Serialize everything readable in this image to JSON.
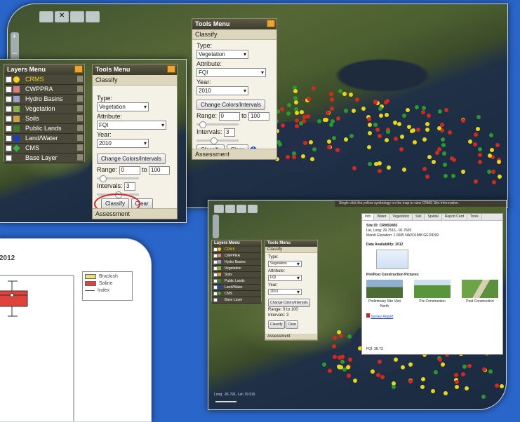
{
  "layers_menu": {
    "title": "Layers Menu",
    "items": [
      {
        "label": "CRMS",
        "icon": "yellow-circle-icon",
        "color": "#f2d21c"
      },
      {
        "label": "CWPPRA",
        "icon": "cwppra-icon",
        "color": "#d97f7f"
      },
      {
        "label": "Hydro Basins",
        "icon": "hydro-basins-icon",
        "color": "#9aa2c8"
      },
      {
        "label": "Vegetation",
        "icon": "vegetation-icon",
        "color": "#8ab04a"
      },
      {
        "label": "Soils",
        "icon": "soils-icon",
        "color": "#c9a347"
      },
      {
        "label": "Public Lands",
        "icon": "public-lands-icon",
        "color": "#3d7d2e"
      },
      {
        "label": "Land/Water",
        "icon": "land-water-icon",
        "color": "#1e3fb8"
      },
      {
        "label": "CMS",
        "icon": "green-diamond-icon",
        "color": "#35b24a"
      },
      {
        "label": "Base Layer",
        "icon": "",
        "color": ""
      }
    ]
  },
  "tools_menu": {
    "title": "Tools Menu",
    "tab": "Classify",
    "type_label": "Type:",
    "type_value": "Vegetation",
    "attribute_label": "Attribute:",
    "attribute_value": "FQI",
    "year_label": "Year:",
    "year_value": "2010",
    "change_button": "Change Colors/Intervals",
    "range_label": "Range:",
    "range_from": "0",
    "range_to_label": "to",
    "range_to": "100",
    "intervals_label": "Intervals:",
    "intervals_value": "3",
    "classify_button": "Classify",
    "clear_button": "Clear",
    "assessment": "Assessment"
  },
  "chart_panel": {
    "title_fragment": "2012",
    "legend": [
      {
        "label": "Brackish",
        "color": "#e9e36a"
      },
      {
        "label": "Saline",
        "color": "#e0433b"
      },
      {
        "label": "Index",
        "color": "#555555"
      }
    ]
  },
  "info_window": {
    "tabs": [
      "Info",
      "Water",
      "Vegetation",
      "Soil",
      "Spatial",
      "Report Card",
      "Tools"
    ],
    "site_id": "Site ID: CRMS0493",
    "lat_long": "Lat, Long: 29.7516, -91.7605",
    "marsh_elev": "Marsh Elevation: 1.0605 NAVD1988 GEOID99",
    "data_avail": "Data Availability: 2012",
    "pictures_title": "Pre/Post Construction Pictures:",
    "pictures": [
      "Preliminary Site Visit North",
      "Pre Construction",
      "Post Construction"
    ],
    "survey_report": "Survey Report",
    "fqi": "FQI: 38.73"
  },
  "hint_bar": "Single click the yellow symbology on the map to view CRMS Site Information.",
  "coords": "Long: -91.791,  Lat: 29.516"
}
